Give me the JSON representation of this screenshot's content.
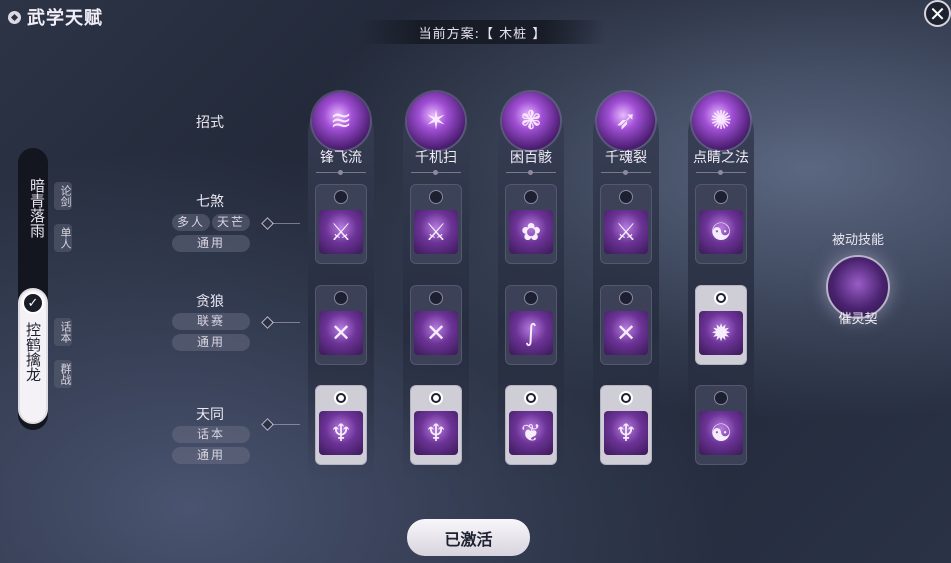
{
  "header": {
    "title": "武学天赋",
    "close": "✕"
  },
  "scheme": {
    "label": "当前方案:【 木桩 】"
  },
  "left": {
    "set1": "暗青落雨",
    "set2": "控鹤擒龙",
    "tags": [
      "论剑",
      "单人",
      "话本",
      "群战"
    ]
  },
  "rows": {
    "header": "招式",
    "items": [
      {
        "name": "七煞",
        "tags": [
          "多人",
          "天芒"
        ],
        "sub": "通用"
      },
      {
        "name": "贪狼",
        "tags": [
          "联赛"
        ],
        "sub": "通用"
      },
      {
        "name": "天同",
        "tags": [
          "话本"
        ],
        "sub": "通用"
      }
    ]
  },
  "skills": [
    "锋飞流",
    "千机扫",
    "困百骸",
    "千魂裂",
    "点睛之法"
  ],
  "passive": {
    "label": "被动技能",
    "name": "催灵契"
  },
  "button": {
    "label": "已激活"
  }
}
